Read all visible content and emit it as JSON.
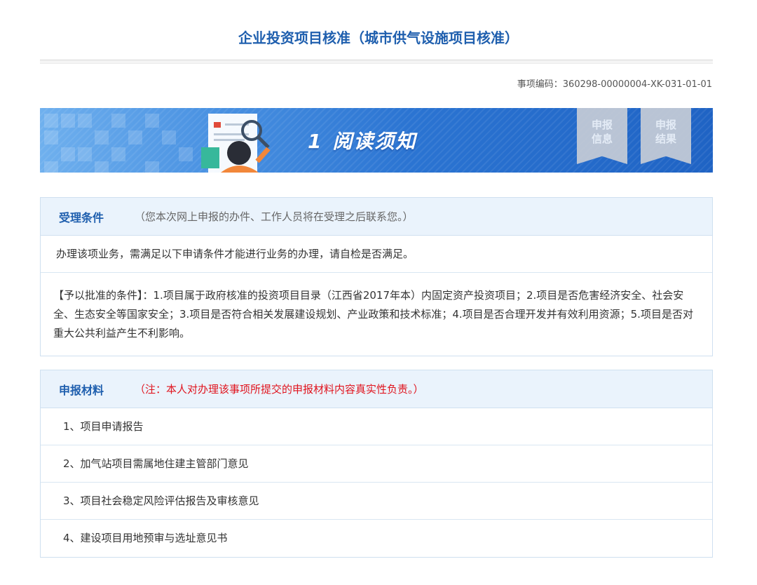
{
  "header": {
    "title": "企业投资项目核准（城市供气设施项目核准）",
    "item_code": "事项编码：360298-00000004-XK-031-01-01"
  },
  "banner": {
    "step_number": "1",
    "step_title": "阅读须知",
    "steps": [
      {
        "line1": "申报",
        "line2": "信息"
      },
      {
        "line1": "申报",
        "line2": "结果"
      }
    ],
    "colors": {
      "start": "#6fb0ee",
      "end": "#1f63c4",
      "flag": "#c7cdd6"
    }
  },
  "conditions": {
    "heading": "受理条件",
    "note": "（您本次网上申报的办件、工作人员将在受理之后联系您。）",
    "intro": "办理该项业务，需满足以下申请条件才能进行业务的办理，请自检是否满足。",
    "detail": "【予以批准的条件】：1.项目属于政府核准的投资项目目录（江西省2017年本）内固定资产投资项目；2.项目是否危害经济安全、社会安全、生态安全等国家安全；3.项目是否符合相关发展建设规划、产业政策和技术标准；4.项目是否合理开发并有效利用资源；5.项目是否对重大公共利益产生不利影响。"
  },
  "materials": {
    "heading": "申报材料",
    "note": "（注：本人对办理该事项所提交的申报材料内容真实性负责。）",
    "items": [
      "1、项目申请报告",
      "2、加气站项目需属地住建主管部门意见",
      "3、项目社会稳定风险评估报告及审核意见",
      "4、建设项目用地预审与选址意见书"
    ]
  },
  "colors": {
    "title": "#1f5fae",
    "panel_header_bg": "#eaf3fc",
    "warning_text": "#e0141e"
  }
}
